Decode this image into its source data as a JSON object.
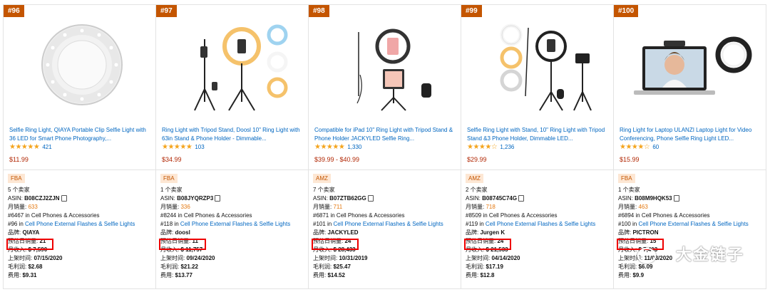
{
  "cards": [
    {
      "rank": "#96",
      "title": "Selfie Ring Light, QIAYA Portable Clip Selfie Light with 36 LED for Smart Phone Photography,...",
      "stars": "★★★★★",
      "rating_count": "421",
      "price": "$11.99",
      "badge": "FBA",
      "sellers": "5 个卖家",
      "asin_label": "ASIN:",
      "asin": "B08CZJ2ZJN",
      "monthly_label": "月销量:",
      "monthly": "633",
      "rank_main": "#6467 in Cell Phones & Accessories",
      "rank_sub_num": "#96 in",
      "rank_sub_cat": "Cell Phone External Flashes & Selfie Lights",
      "brand_label": "品牌:",
      "brand": "QIAYA",
      "daily_label": "预估日销量:",
      "daily": "21",
      "revenue_label": "月收入:",
      "revenue": "$ 7,590",
      "listed_label": "上架时间:",
      "listed": "07/15/2020",
      "profit_label": "毛利润:",
      "profit": "$2.68",
      "fee_label": "费用:",
      "fee": "$9.31"
    },
    {
      "rank": "#97",
      "title": "Ring Light with Tripod Stand, Doosl 10\" Ring Light with 63in Stand & Phone Holder - Dimmable...",
      "stars": "★★★★★",
      "rating_count": "103",
      "price": "$34.99",
      "badge": "FBA",
      "sellers": "1 个卖家",
      "asin_label": "ASIN:",
      "asin": "B08JYQRZP3",
      "monthly_label": "月销量:",
      "monthly": "336",
      "rank_main": "#8244 in Cell Phones & Accessories",
      "rank_sub_num": "#118 in",
      "rank_sub_cat": "Cell Phone External Flashes & Selfie Lights",
      "brand_label": "品牌:",
      "brand": "doosl",
      "daily_label": "预估日销量:",
      "daily": "11",
      "revenue_label": "月收入:",
      "revenue": "$ 11,757",
      "listed_label": "上架时间:",
      "listed": "09/24/2020",
      "profit_label": "毛利润:",
      "profit": "$21.22",
      "fee_label": "费用:",
      "fee": "$13.77"
    },
    {
      "rank": "#98",
      "title": "Compatible for iPad 10\" Ring Light with Tripod Stand & Phone Holder JACKYLED Selfie Ring...",
      "stars": "★★★★★",
      "rating_count": "1,330",
      "price": "$39.99 - $40.99",
      "badge": "AMZ",
      "sellers": "7 个卖家",
      "asin_label": "ASIN:",
      "asin": "B07ZTB62GG",
      "monthly_label": "月销量:",
      "monthly": "711",
      "rank_main": "#6871 in Cell Phones & Accessories",
      "rank_sub_num": "#101 in",
      "rank_sub_cat": "Cell Phone External Flashes & Selfie Lights",
      "brand_label": "品牌:",
      "brand": "JACKYLED",
      "daily_label": "预估日销量:",
      "daily": "24",
      "revenue_label": "月收入:",
      "revenue": "$ 28,433",
      "listed_label": "上架时间:",
      "listed": "10/31/2019",
      "profit_label": "毛利润:",
      "profit": "$25.47",
      "fee_label": "费用:",
      "fee": "$14.52"
    },
    {
      "rank": "#99",
      "title": "Selfie Ring Light with Stand, 10\" Ring Light with Tripod Stand &3 Phone Holder, Dimmable LED...",
      "stars": "★★★★☆",
      "rating_count": "1,236",
      "price": "$29.99",
      "badge": "AMZ",
      "sellers": "2 个卖家",
      "asin_label": "ASIN:",
      "asin": "B08745C74G",
      "monthly_label": "月销量:",
      "monthly": "718",
      "rank_main": "#8509 in Cell Phones & Accessories",
      "rank_sub_num": "#119 in",
      "rank_sub_cat": "Cell Phone External Flashes & Selfie Lights",
      "brand_label": "品牌:",
      "brand": "Jurgen K",
      "daily_label": "预估日销量:",
      "daily": "24",
      "revenue_label": "月收入:",
      "revenue": "$ 21,533",
      "listed_label": "上架时间:",
      "listed": "04/14/2020",
      "profit_label": "毛利润:",
      "profit": "$17.19",
      "fee_label": "费用:",
      "fee": "$12.8"
    },
    {
      "rank": "#100",
      "title": "Ring Light for Laptop ULANZI Laptop Light for Video Conferencing, Phone Selfie Ring Light LED...",
      "stars": "★★★★☆",
      "rating_count": "60",
      "price": "$15.99",
      "badge": "FBA",
      "sellers": "1 个卖家",
      "asin_label": "ASIN:",
      "asin": "B08M9HQK53",
      "monthly_label": "月销量:",
      "monthly": "463",
      "rank_main": "#6894 in Cell Phones & Accessories",
      "rank_sub_num": "#100 in",
      "rank_sub_cat": "Cell Phone External Flashes & Selfie Lights",
      "brand_label": "品牌:",
      "brand": "PICTRON",
      "daily_label": "预估日销量:",
      "daily": "15",
      "revenue_label": "月收入:",
      "revenue": "$ 7,403",
      "listed_label": "上架时间:",
      "listed": "11/03/2020",
      "profit_label": "毛利润:",
      "profit": "$6.09",
      "fee_label": "费用:",
      "fee": "$9.9"
    }
  ],
  "watermark": "大金链子"
}
